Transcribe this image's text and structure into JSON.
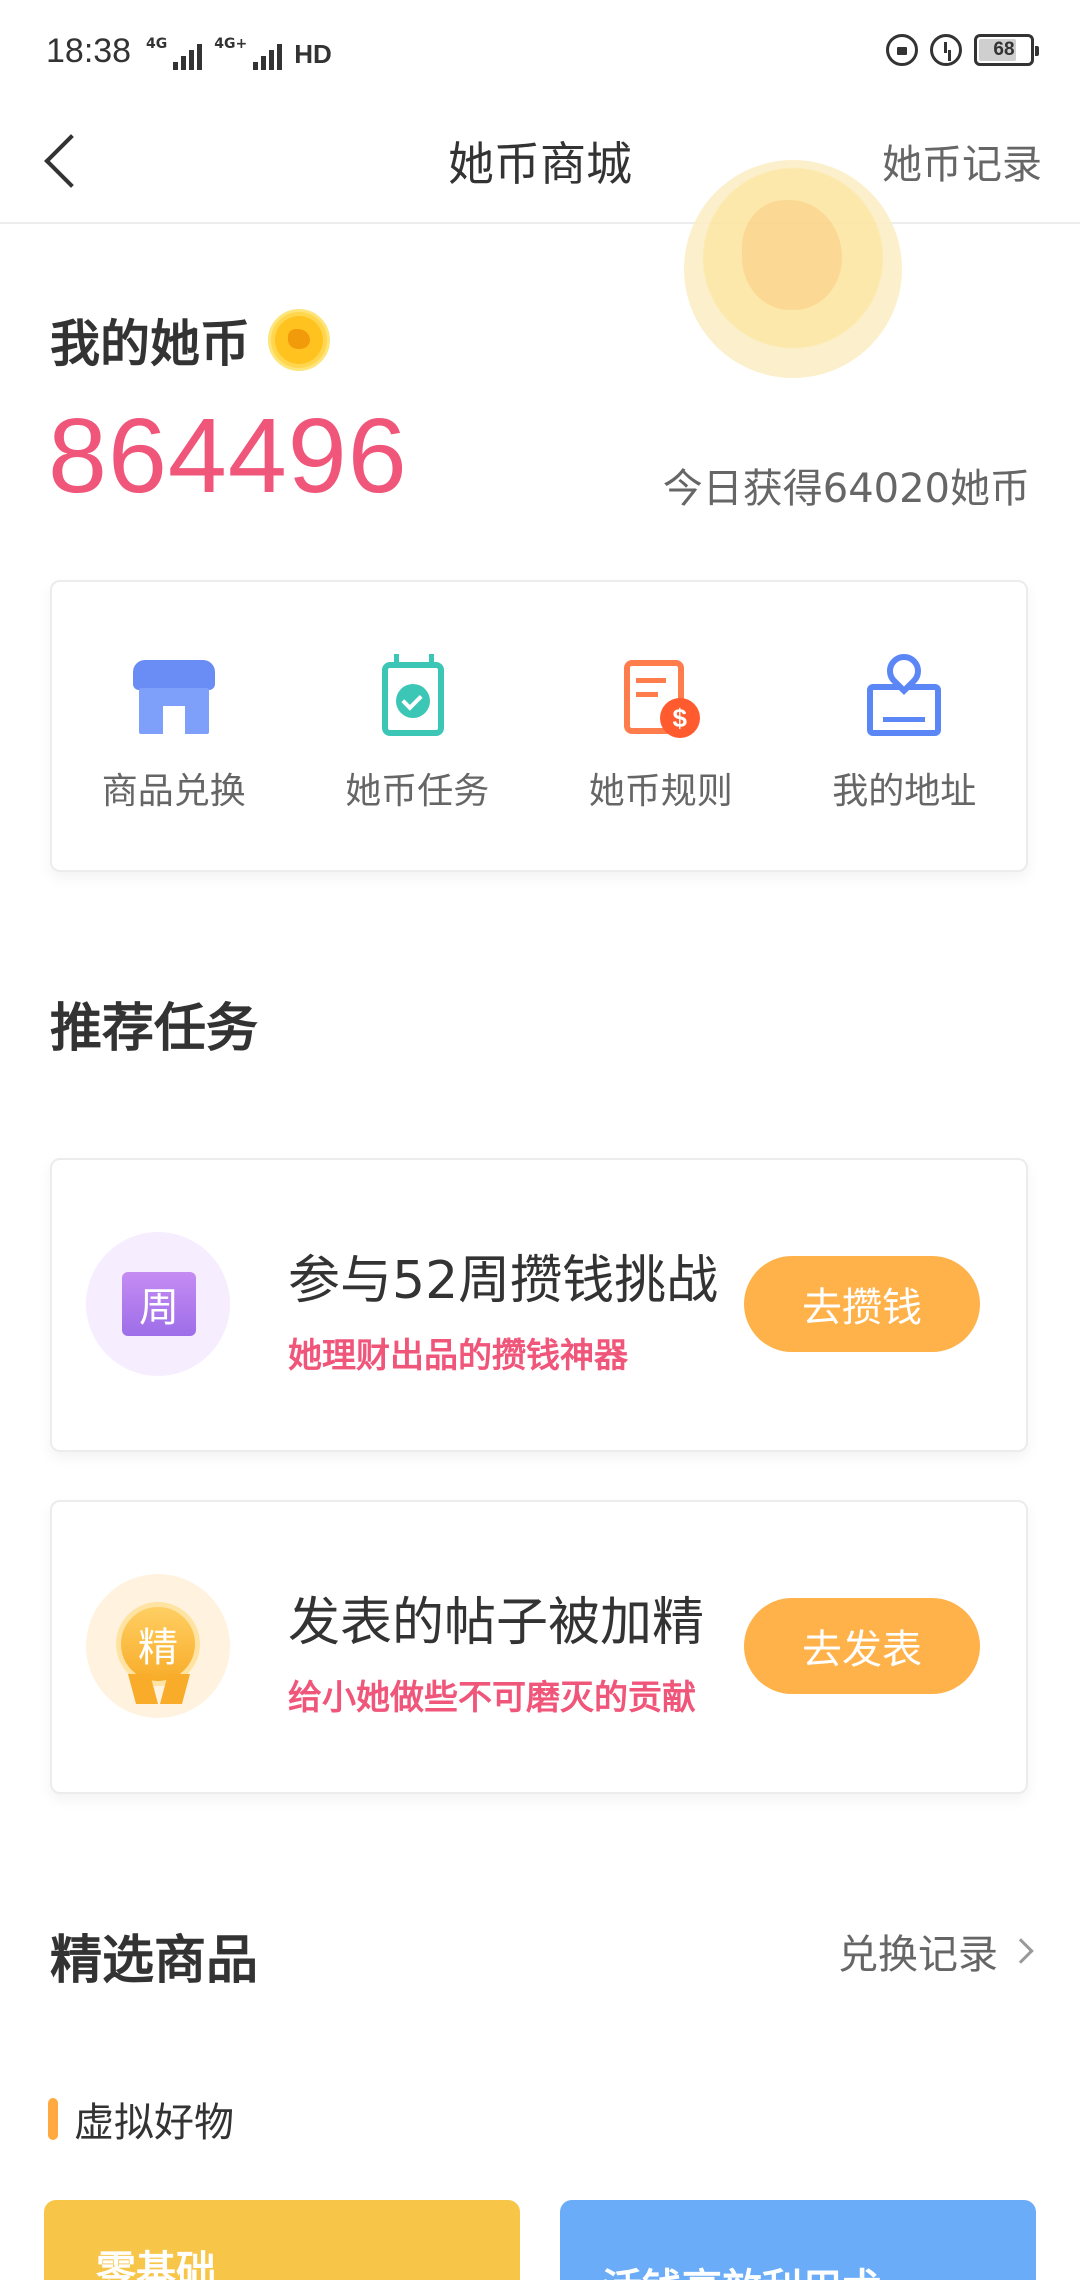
{
  "status_bar": {
    "time": "18:38",
    "net1": "4G",
    "net2": "4G+",
    "hd": "HD",
    "battery": "68"
  },
  "nav": {
    "title": "她币商城",
    "right_link": "她币记录"
  },
  "coins": {
    "label": "我的她币",
    "amount": "864496",
    "today": "今日获得64020她币"
  },
  "menu": [
    {
      "label": "商品兑换",
      "icon": "store-icon"
    },
    {
      "label": "她币任务",
      "icon": "task-checklist-icon"
    },
    {
      "label": "她币规则",
      "icon": "rules-document-icon"
    },
    {
      "label": "我的地址",
      "icon": "location-address-icon"
    }
  ],
  "recommended": {
    "title": "推荐任务",
    "tasks": [
      {
        "badge": "周",
        "title": "参与52周攒钱挑战",
        "subtitle": "她理财出品的攒钱神器",
        "button": "去攒钱"
      },
      {
        "badge": "精",
        "title": "发表的帖子被加精",
        "subtitle": "给小她做些不可磨灭的贡献",
        "button": "去发表"
      }
    ]
  },
  "products": {
    "title": "精选商品",
    "link": "兑换记录",
    "category": "虚拟好物",
    "cards": [
      {
        "text": "零基础"
      },
      {
        "text": "活钱高效利用术"
      }
    ]
  },
  "colors": {
    "accent_pink": "#f0557a",
    "button_orange": "#ffb24a"
  }
}
